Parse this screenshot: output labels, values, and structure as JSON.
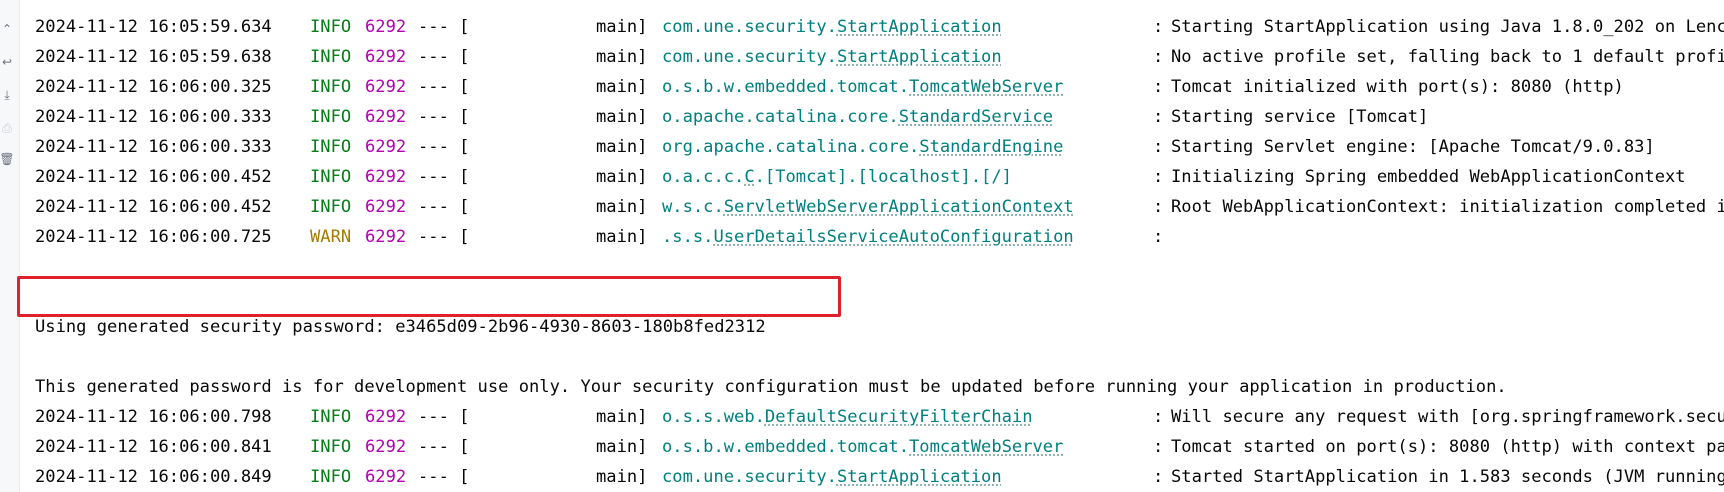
{
  "gutter": {
    "icons": [
      "scroll-up-icon",
      "soft-wrap-icon",
      "scroll-to-end-icon",
      "print-icon",
      "clear-all-icon"
    ]
  },
  "log": {
    "rows1": [
      {
        "ts": "2024-11-12 16:05:59.634",
        "level": "INFO",
        "pid": "6292",
        "sep": "--- [",
        "thread": "main]",
        "logger_pkg": "com.une.security.",
        "logger_cls": "StartApplication",
        "colon": ":",
        "msg": "Starting StartApplication using Java 1.8.0_202 on Lenc"
      },
      {
        "ts": "2024-11-12 16:05:59.638",
        "level": "INFO",
        "pid": "6292",
        "sep": "--- [",
        "thread": "main]",
        "logger_pkg": "com.une.security.",
        "logger_cls": "StartApplication",
        "colon": ":",
        "msg": "No active profile set, falling back to 1 default profi"
      },
      {
        "ts": "2024-11-12 16:06:00.325",
        "level": "INFO",
        "pid": "6292",
        "sep": "--- [",
        "thread": "main]",
        "logger_pkg": "o.s.b.w.embedded.tomcat.",
        "logger_cls": "TomcatWebServer",
        "colon": ":",
        "msg": "Tomcat initialized with port(s): 8080 (http)"
      },
      {
        "ts": "2024-11-12 16:06:00.333",
        "level": "INFO",
        "pid": "6292",
        "sep": "--- [",
        "thread": "main]",
        "logger_pkg": "o.apache.catalina.core.",
        "logger_cls": "StandardService",
        "colon": ":",
        "msg": "Starting service [Tomcat]"
      },
      {
        "ts": "2024-11-12 16:06:00.333",
        "level": "INFO",
        "pid": "6292",
        "sep": "--- [",
        "thread": "main]",
        "logger_pkg": "org.apache.catalina.core.",
        "logger_cls": "StandardEngine",
        "colon": ":",
        "msg": "Starting Servlet engine: [Apache Tomcat/9.0.83]"
      },
      {
        "ts": "2024-11-12 16:06:00.452",
        "level": "INFO",
        "pid": "6292",
        "sep": "--- [",
        "thread": "main]",
        "logger_pkg": "o.a.c.c.",
        "logger_cls": "C",
        "logger_rest": ".[Tomcat].[localhost].[/]",
        "colon": ":",
        "msg": "Initializing Spring embedded WebApplicationContext"
      },
      {
        "ts": "2024-11-12 16:06:00.452",
        "level": "INFO",
        "pid": "6292",
        "sep": "--- [",
        "thread": "main]",
        "logger_pkg": "w.s.c.",
        "logger_cls": "ServletWebServerApplicationContext",
        "colon": ":",
        "msg": "Root WebApplicationContext: initialization completed i"
      },
      {
        "ts": "2024-11-12 16:06:00.725",
        "level": "WARN",
        "pid": "6292",
        "sep": "--- [",
        "thread": "main]",
        "logger_pkg": ".s.s.",
        "logger_cls": "UserDetailsServiceAutoConfiguration",
        "colon": ":",
        "msg": ""
      }
    ],
    "password_line": "Using generated security password: e3465d09-2b96-4930-8603-180b8fed2312",
    "notice_line": "This generated password is for development use only. Your security configuration must be updated before running your application in production.",
    "rows2": [
      {
        "ts": "2024-11-12 16:06:00.798",
        "level": "INFO",
        "pid": "6292",
        "sep": "--- [",
        "thread": "main]",
        "logger_pkg": "o.s.s.web.",
        "logger_cls": "DefaultSecurityFilterChain",
        "colon": ":",
        "msg": "Will secure any request with [org.springframework.secu"
      },
      {
        "ts": "2024-11-12 16:06:00.841",
        "level": "INFO",
        "pid": "6292",
        "sep": "--- [",
        "thread": "main]",
        "logger_pkg": "o.s.b.w.embedded.tomcat.",
        "logger_cls": "TomcatWebServer",
        "colon": ":",
        "msg": "Tomcat started on port(s): 8080 (http) with context pa"
      },
      {
        "ts": "2024-11-12 16:06:00.849",
        "level": "INFO",
        "pid": "6292",
        "sep": "--- [",
        "thread": "main]",
        "logger_pkg": "com.une.security.",
        "logger_cls": "StartApplication",
        "colon": ":",
        "msg": "Started StartApplication in 1.583 seconds (JVM running"
      }
    ]
  }
}
